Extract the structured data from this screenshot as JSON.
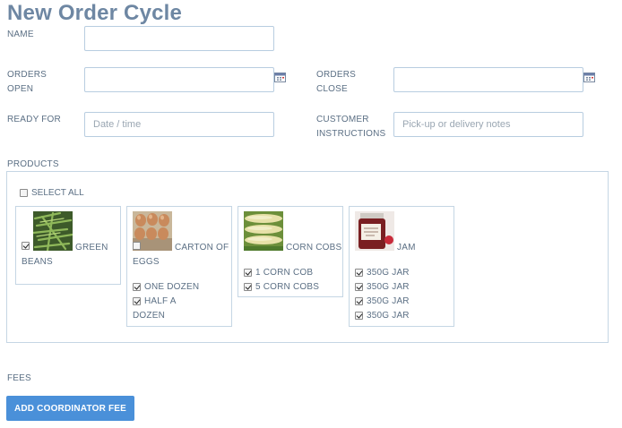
{
  "page": {
    "title": "New Order Cycle"
  },
  "form": {
    "name_label": "NAME",
    "name_value": "",
    "orders_open_label_1": "ORDERS",
    "orders_open_label_2": "OPEN",
    "orders_open_value": "",
    "orders_close_label_1": "ORDERS",
    "orders_close_label_2": "CLOSE",
    "orders_close_value": "",
    "ready_for_label": "READY FOR",
    "ready_for_placeholder": "Date / time",
    "customer_instructions_label_1": "CUSTOMER",
    "customer_instructions_label_2": "INSTRUCTIONS",
    "customer_instructions_placeholder": "Pick-up or delivery notes"
  },
  "products": {
    "label": "PRODUCTS",
    "select_all_label": "SELECT ALL",
    "select_all_checked": false,
    "items": [
      {
        "name_line1": "GREEN",
        "name_line2": "BEANS",
        "checked": true,
        "image": "green-beans",
        "variants": []
      },
      {
        "name_line1": "CARTON OF",
        "name_line2": "EGGS",
        "checked": false,
        "image": "eggs",
        "variants": [
          {
            "line1": "ONE DOZEN",
            "line2": "",
            "checked": true
          },
          {
            "line1": "HALF A",
            "line2": "DOZEN",
            "checked": true
          }
        ]
      },
      {
        "name_line1": "CORN COBS",
        "name_line2": "",
        "checked": false,
        "image": "corn",
        "variants": [
          {
            "line1": "1 CORN COB",
            "line2": "",
            "checked": true
          },
          {
            "line1": "5 CORN COBS",
            "line2": "",
            "checked": true
          }
        ]
      },
      {
        "name_line1": "JAM",
        "name_line2": "",
        "checked": false,
        "image": "jam",
        "variants": [
          {
            "line1": "350G JAR",
            "line2": "",
            "checked": true
          },
          {
            "line1": "350G JAR",
            "line2": "",
            "checked": true
          },
          {
            "line1": "350G JAR",
            "line2": "",
            "checked": true
          },
          {
            "line1": "350G JAR",
            "line2": "",
            "checked": true
          }
        ]
      }
    ]
  },
  "fees": {
    "label": "FEES",
    "add_button_label": "ADD COORDINATOR FEE"
  },
  "colors": {
    "accent": "#4a90d9",
    "title": "#6e87a3",
    "label": "#5b6f84",
    "border": "#c5d6e4"
  }
}
